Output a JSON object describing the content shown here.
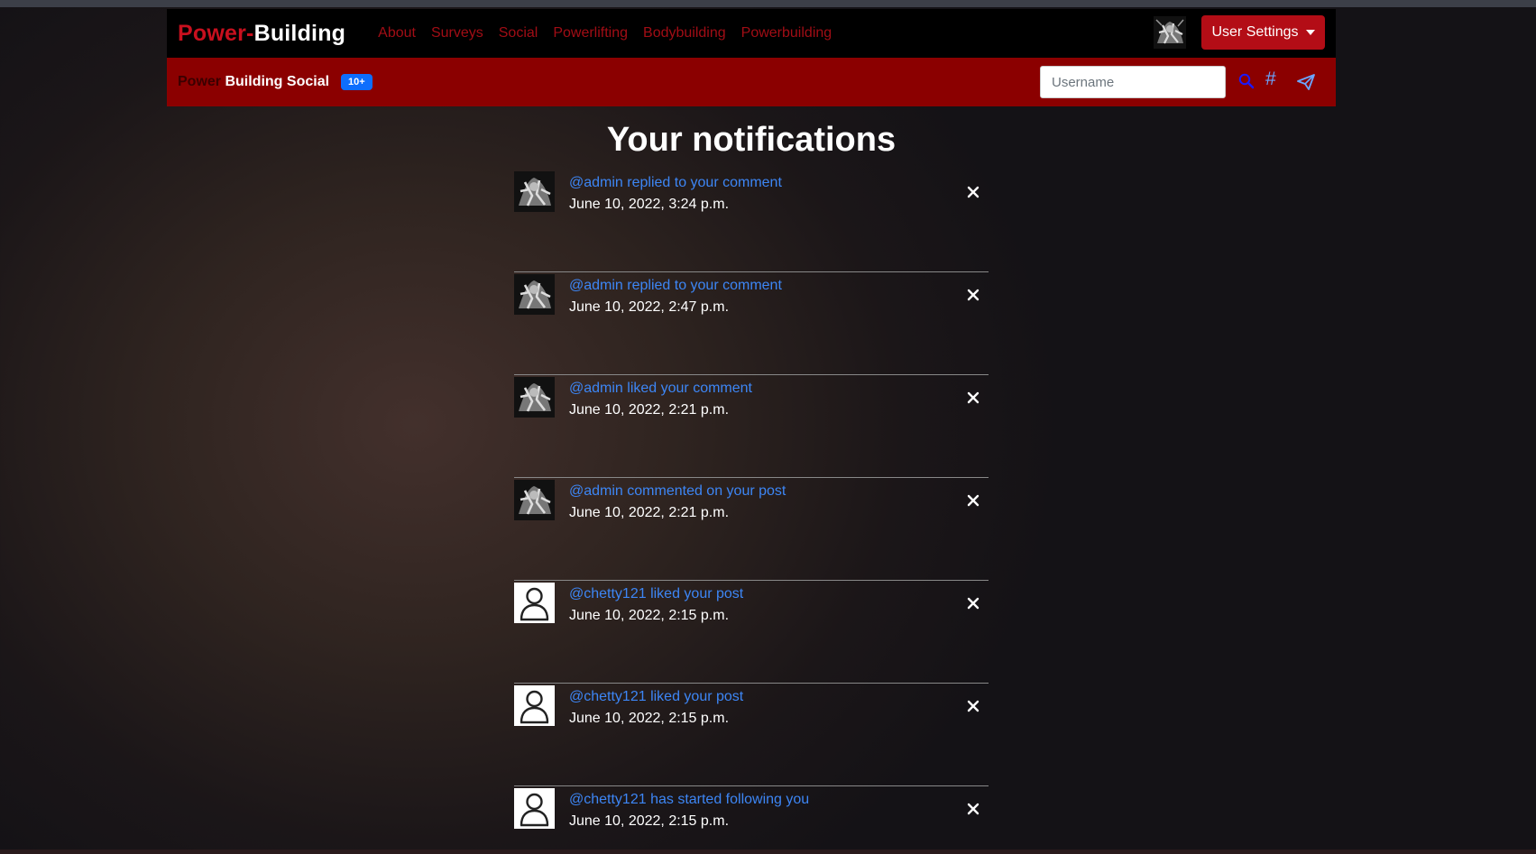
{
  "brand": {
    "part1": "Power-",
    "part2": "Building"
  },
  "nav": {
    "links": [
      "About",
      "Surveys",
      "Social",
      "Powerlifting",
      "Bodybuilding",
      "Powerbuilding"
    ]
  },
  "user_settings": {
    "label": "User Settings"
  },
  "social": {
    "brand_prefix": "Power",
    "brand_rest": "Building Social",
    "badge": "10+",
    "search_placeholder": "Username",
    "hash_symbol": "#"
  },
  "page": {
    "title": "Your notifications"
  },
  "notifications": [
    {
      "text": "@admin replied to your comment",
      "time": "June 10, 2022, 3:24 p.m.",
      "avatar": "admin-avatar"
    },
    {
      "text": "@admin replied to your comment",
      "time": "June 10, 2022, 2:47 p.m.",
      "avatar": "admin-avatar"
    },
    {
      "text": "@admin liked your comment",
      "time": "June 10, 2022, 2:21 p.m.",
      "avatar": "admin-avatar"
    },
    {
      "text": "@admin commented on your post",
      "time": "June 10, 2022, 2:21 p.m.",
      "avatar": "admin-avatar"
    },
    {
      "text": "@chetty121 liked your post",
      "time": "June 10, 2022, 2:15 p.m.",
      "avatar": "default-user-avatar"
    },
    {
      "text": "@chetty121 liked your post",
      "time": "June 10, 2022, 2:15 p.m.",
      "avatar": "default-user-avatar"
    },
    {
      "text": "@chetty121 has started following you",
      "time": "June 10, 2022, 2:15 p.m.",
      "avatar": "default-user-avatar"
    }
  ],
  "colors": {
    "brand_red": "#c8101e",
    "nav_link": "#a10d15",
    "subbar": "#8b0000",
    "settings_button": "#b30d16",
    "badge": "#0d6efd",
    "notif_link": "#3d86f5"
  }
}
